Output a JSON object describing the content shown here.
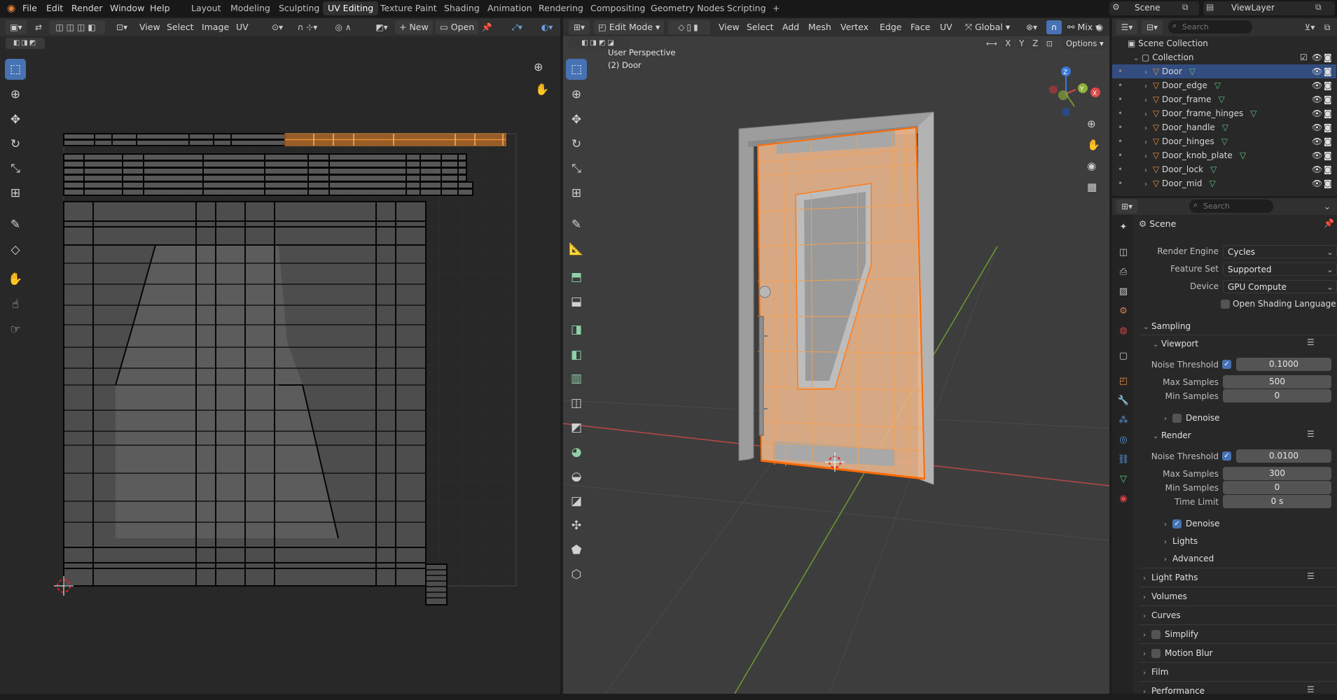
{
  "menu": {
    "logo": "blender-logo-icon",
    "items": [
      "File",
      "Edit",
      "Render",
      "Window",
      "Help"
    ]
  },
  "workspaces": [
    "Layout",
    "Modeling",
    "Sculpting",
    "UV Editing",
    "Texture Paint",
    "Shading",
    "Animation",
    "Rendering",
    "Compositing",
    "Geometry Nodes",
    "Scripting"
  ],
  "active_workspace": "UV Editing",
  "topright": {
    "scene": "Scene",
    "view_layer": "ViewLayer"
  },
  "uv_editor": {
    "menus": [
      "View",
      "Select",
      "Image",
      "UV"
    ],
    "new_label": "New",
    "open_label": "Open"
  },
  "viewport": {
    "mode": "Edit Mode",
    "menus": [
      "View",
      "Select",
      "Add",
      "Mesh",
      "Vertex",
      "Edge",
      "Face",
      "UV"
    ],
    "orientation": "Global",
    "shading": "Mix",
    "options": "Options",
    "axes": [
      "X",
      "Y",
      "Z"
    ],
    "info_line1": "User Perspective",
    "info_line2": "(2) Door"
  },
  "outliner": {
    "search_placeholder": "Search",
    "scene_collection": "Scene Collection",
    "collection": "Collection",
    "objects": [
      "Door",
      "Door_edge",
      "Door_frame",
      "Door_frame_hinges",
      "Door_handle",
      "Door_hinges",
      "Door_knob_plate",
      "Door_lock",
      "Door_mid"
    ],
    "selected": "Door"
  },
  "properties": {
    "search_placeholder": "Search",
    "context": "Scene",
    "render_engine_label": "Render Engine",
    "render_engine": "Cycles",
    "feature_set_label": "Feature Set",
    "feature_set": "Supported",
    "device_label": "Device",
    "device": "GPU Compute",
    "osl_label": "Open Shading Language",
    "sampling": "Sampling",
    "viewport": "Viewport",
    "noise_threshold_label": "Noise Threshold",
    "vp_noise_threshold": "0.1000",
    "max_samples_label": "Max Samples",
    "vp_max_samples": "500",
    "min_samples_label": "Min Samples",
    "vp_min_samples": "0",
    "denoise_label": "Denoise",
    "render": "Render",
    "r_noise_threshold": "0.0100",
    "r_max_samples": "300",
    "r_min_samples": "0",
    "time_limit_label": "Time Limit",
    "r_time_limit": "0 s",
    "lights": "Lights",
    "advanced": "Advanced",
    "sections": [
      "Light Paths",
      "Volumes",
      "Curves",
      "Simplify",
      "Motion Blur",
      "Film",
      "Performance"
    ]
  },
  "colors": {
    "accent": "#4772b3",
    "selection_orange": "#f08a2a",
    "face_select_fill": "#e8b48c",
    "background": "#282828"
  }
}
